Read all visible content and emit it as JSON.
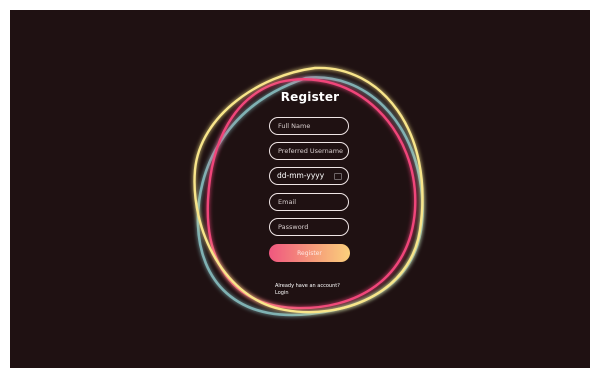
{
  "form": {
    "title": "Register",
    "fields": {
      "full_name_placeholder": "Full Name",
      "username_placeholder": "Preferred Username",
      "date_value": "dd-mm-yyyy",
      "email_placeholder": "Email",
      "password_placeholder": "Password"
    },
    "submit_label": "Register",
    "account_prompt": "Already have an account?",
    "login_link": "Login"
  },
  "colors": {
    "background": "#1f1112",
    "ring_yellow": "#f8e58a",
    "ring_pink": "#f0457a",
    "ring_teal": "#7fb1b3",
    "button_gradient": [
      "#f0577f",
      "#fbd07c"
    ]
  }
}
